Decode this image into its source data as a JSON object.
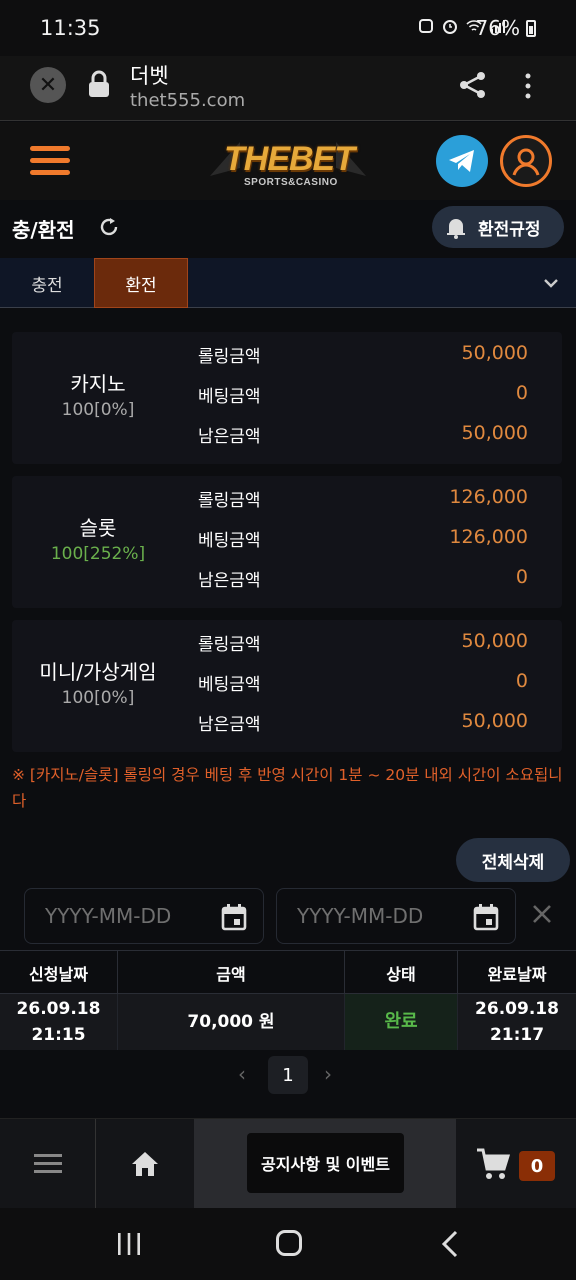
{
  "status_bar": {
    "time": "11:35",
    "battery": "76%"
  },
  "browser": {
    "title": "더벳",
    "url": "thet555.com"
  },
  "site": {
    "logo_main": "THEBET",
    "logo_sub": "SPORTS&CASINO"
  },
  "page": {
    "title": "충/환전",
    "rules_button": "환전규정"
  },
  "tabs": [
    {
      "label": "충전",
      "active": false
    },
    {
      "label": "환전",
      "active": true
    }
  ],
  "rolling": {
    "labels": {
      "rolling": "롤링금액",
      "betting": "베팅금액",
      "remaining": "남은금액"
    },
    "cards": [
      {
        "name": "카지노",
        "rate": "100[0%]",
        "rolling": "50,000",
        "betting": "0",
        "remaining": "50,000"
      },
      {
        "name": "슬롯",
        "rate": "100[252%]",
        "rolling": "126,000",
        "betting": "126,000",
        "remaining": "0"
      },
      {
        "name": "미니/가상게임",
        "rate": "100[0%]",
        "rolling": "50,000",
        "betting": "0",
        "remaining": "50,000"
      }
    ]
  },
  "notice": "※ [카지노/슬롯] 롤링의 경우 베팅 후 반영 시간이 1분 ~ 20분 내외 시간이 소요됩니다",
  "delete_all": "전체삭제",
  "filters": {
    "start_placeholder": "YYYY-MM-DD",
    "end_placeholder": "YYYY-MM-DD"
  },
  "table": {
    "headers": [
      "신청날짜",
      "금액",
      "상태",
      "완료날짜"
    ],
    "rows": [
      {
        "request_date": "26.09.18",
        "request_time": "21:15",
        "amount": "70,000 원",
        "status": "완료",
        "complete_date": "26.09.18",
        "complete_time": "21:17"
      }
    ]
  },
  "pagination": {
    "current": "1",
    "prev": "‹",
    "next": "›"
  },
  "bottom_nav": {
    "notice_label": "공지사항 및 이벤트",
    "cart_count": "0"
  },
  "colors": {
    "accent": "#f07a2c",
    "value": "#e0893f",
    "status_done": "#58b94a",
    "notice_text": "#e0602a"
  }
}
